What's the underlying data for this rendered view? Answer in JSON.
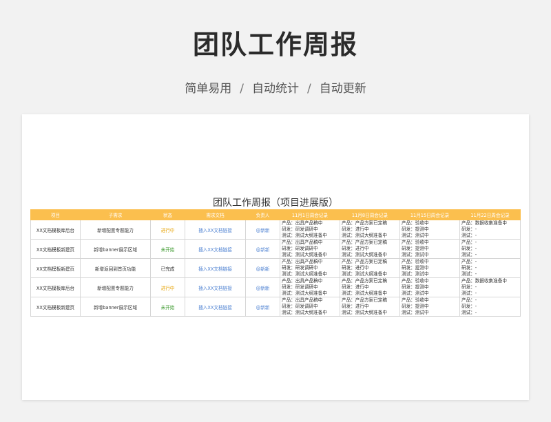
{
  "header": {
    "title": "团队工作周报",
    "tags": [
      "简单易用",
      "自动统计",
      "自动更新"
    ],
    "separator": "/"
  },
  "sheet": {
    "title": "团队工作周报（项目进展版）",
    "columns": [
      "项目",
      "子需求",
      "状态",
      "需求文档",
      "负责人",
      "11月1日周会记录",
      "11月8日周会记录",
      "11月15日周会记录",
      "11月22日周会记录"
    ],
    "rows": [
      {
        "project": "XX文档模板库后台",
        "sub": "新增配置专题能力",
        "status": "进行中",
        "status_kind": "progress",
        "doc": "插入XX文档链接",
        "owner": "@新新",
        "w1": [
          "产品：出具产品稿中",
          "研发：研发调研中",
          "测试：测试大纲准备中"
        ],
        "w2": [
          "产品：产品方案已定稿",
          "研发：进行中",
          "测试：测试大纲准备中"
        ],
        "w3": [
          "产品：验收中",
          "研发：提测中",
          "测试：测试中"
        ],
        "w4": [
          "产品：数据收集准备中",
          "研发：-",
          "测试：-"
        ]
      },
      {
        "project": "XX文档模板新建页",
        "sub": "新增banner展示区域",
        "status": "未开始",
        "status_kind": "notstart",
        "doc": "插入XX文档链接",
        "owner": "@新新",
        "w1": [
          "产品：出具产品稿中",
          "研发：研发调研中",
          "测试：测试大纲准备中"
        ],
        "w2": [
          "产品：产品方案已定稿",
          "研发：进行中",
          "测试：测试大纲准备中"
        ],
        "w3": [
          "产品：验收中",
          "研发：提测中",
          "测试：测试中"
        ],
        "w4": [
          "产品：-",
          "研发：-",
          "测试：-"
        ]
      },
      {
        "project": "XX文档模板新建页",
        "sub": "新增返回到首页功能",
        "status": "已完成",
        "status_kind": "done",
        "doc": "插入XX文档链接",
        "owner": "@新新",
        "w1": [
          "产品：出具产品稿中",
          "研发：研发调研中",
          "测试：测试大纲准备中"
        ],
        "w2": [
          "产品：产品方案已定稿",
          "研发：进行中",
          "测试：测试大纲准备中"
        ],
        "w3": [
          "产品：验收中",
          "研发：提测中",
          "测试：测试中"
        ],
        "w4": [
          "产品：-",
          "研发：-",
          "测试：-"
        ]
      },
      {
        "project": "XX文档模板库后台",
        "sub": "新增配置专题能力",
        "status": "进行中",
        "status_kind": "progress",
        "doc": "插入XX文档链接",
        "owner": "@新新",
        "w1": [
          "产品：出具产品稿中",
          "研发：研发调研中",
          "测试：测试大纲准备中"
        ],
        "w2": [
          "产品：产品方案已定稿",
          "研发：进行中",
          "测试：测试大纲准备中"
        ],
        "w3": [
          "产品：验收中",
          "研发：提测中",
          "测试：测试中"
        ],
        "w4": [
          "产品：数据收集准备中",
          "研发：-",
          "测试：-"
        ]
      },
      {
        "project": "XX文档模板新建页",
        "sub": "新增banner展示区域",
        "status": "未开始",
        "status_kind": "notstart",
        "doc": "插入XX文档链接",
        "owner": "@新新",
        "w1": [
          "产品：出具产品稿中",
          "研发：研发调研中",
          "测试：测试大纲准备中"
        ],
        "w2": [
          "产品：产品方案已定稿",
          "研发：进行中",
          "测试：测试大纲准备中"
        ],
        "w3": [
          "产品：验收中",
          "研发：提测中",
          "测试：测试中"
        ],
        "w4": [
          "产品：-",
          "研发：-",
          "测试：-"
        ]
      }
    ]
  },
  "colors": {
    "header_bg": "#fbbf4e",
    "status_progress": "#e6a100",
    "status_notstart": "#3c9a2e",
    "link": "#4a7fd1"
  }
}
